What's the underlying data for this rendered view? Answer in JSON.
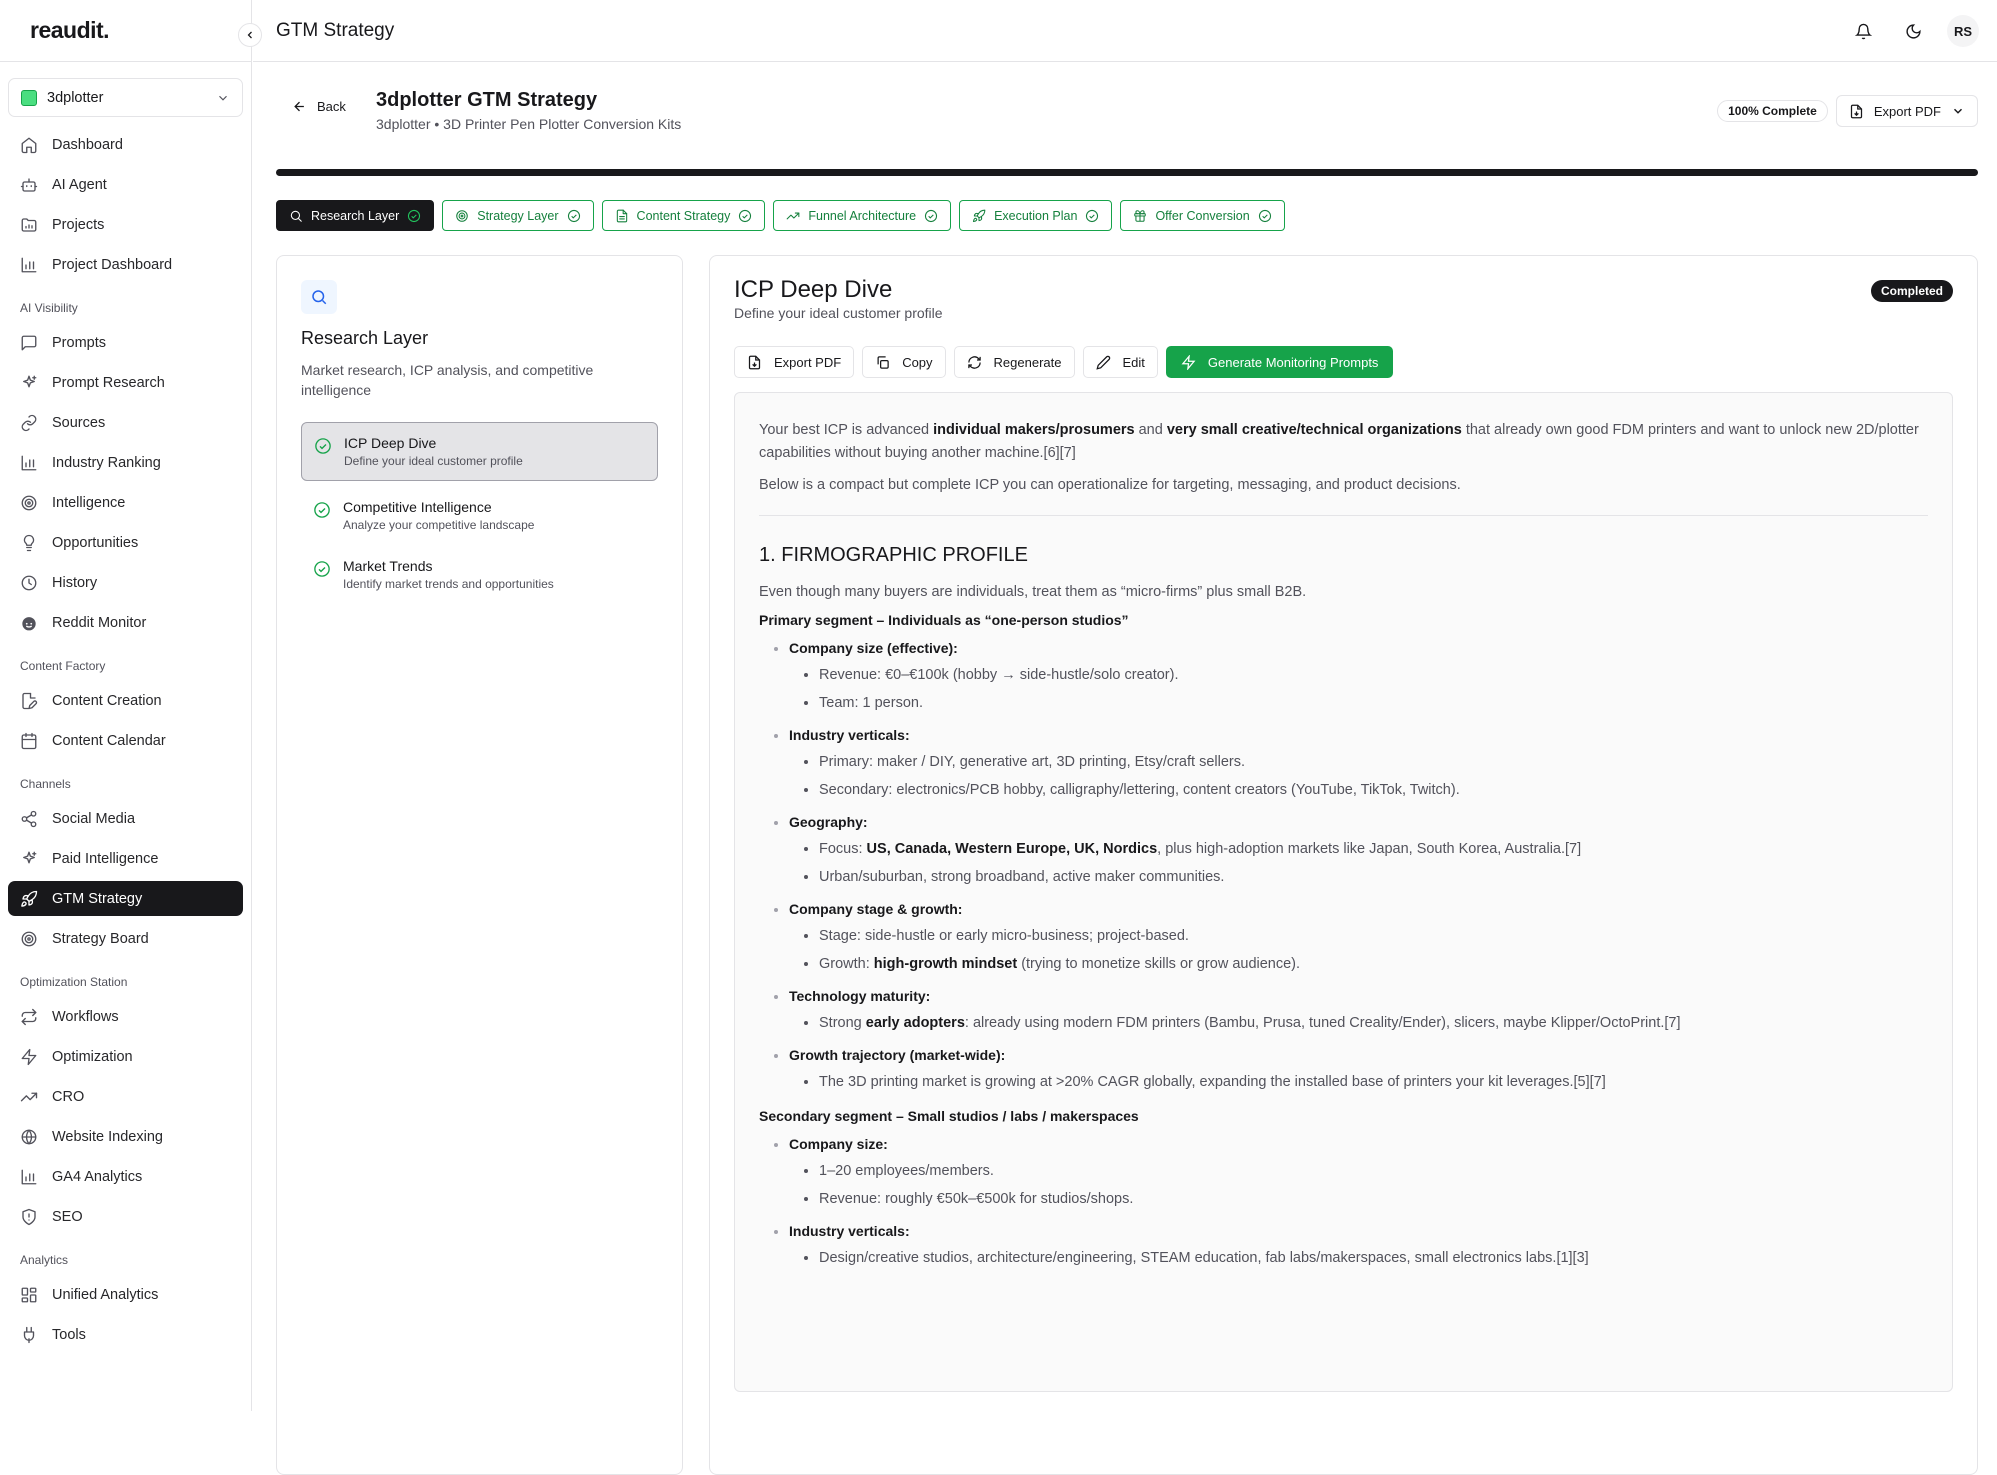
{
  "app": {
    "logo": "reaudit.",
    "page_title": "GTM Strategy",
    "avatar_initials": "RS"
  },
  "sidebar": {
    "project": "3dplotter",
    "groups": [
      {
        "label": "",
        "items": [
          {
            "label": "Dashboard",
            "icon": "home-icon"
          },
          {
            "label": "AI Agent",
            "icon": "bot-icon"
          },
          {
            "label": "Projects",
            "icon": "folder-icon"
          },
          {
            "label": "Project Dashboard",
            "icon": "bar-chart-icon"
          }
        ]
      },
      {
        "label": "AI Visibility",
        "items": [
          {
            "label": "Prompts",
            "icon": "message-icon"
          },
          {
            "label": "Prompt Research",
            "icon": "sparkles-icon"
          },
          {
            "label": "Sources",
            "icon": "link-icon"
          },
          {
            "label": "Industry Ranking",
            "icon": "bar-chart-icon"
          },
          {
            "label": "Intelligence",
            "icon": "target-icon"
          },
          {
            "label": "Opportunities",
            "icon": "lightbulb-icon"
          },
          {
            "label": "History",
            "icon": "clock-icon"
          },
          {
            "label": "Reddit Monitor",
            "icon": "reddit-icon"
          }
        ]
      },
      {
        "label": "Content Factory",
        "items": [
          {
            "label": "Content Creation",
            "icon": "file-pen-icon"
          },
          {
            "label": "Content Calendar",
            "icon": "calendar-icon"
          }
        ]
      },
      {
        "label": "Channels",
        "items": [
          {
            "label": "Social Media",
            "icon": "share-icon"
          },
          {
            "label": "Paid Intelligence",
            "icon": "sparkles-icon"
          },
          {
            "label": "GTM Strategy",
            "icon": "rocket-icon",
            "active": true
          },
          {
            "label": "Strategy Board",
            "icon": "target-icon"
          }
        ]
      },
      {
        "label": "Optimization Station",
        "items": [
          {
            "label": "Workflows",
            "icon": "repeat-icon"
          },
          {
            "label": "Optimization",
            "icon": "zap-icon"
          },
          {
            "label": "CRO",
            "icon": "trending-up-icon"
          },
          {
            "label": "Website Indexing",
            "icon": "globe-icon"
          },
          {
            "label": "GA4 Analytics",
            "icon": "bar-chart-icon"
          },
          {
            "label": "SEO",
            "icon": "shield-icon"
          }
        ]
      },
      {
        "label": "Analytics",
        "items": [
          {
            "label": "Unified Analytics",
            "icon": "grid-icon"
          },
          {
            "label": "Tools",
            "icon": "plug-icon"
          }
        ]
      }
    ]
  },
  "header": {
    "back_label": "Back",
    "title": "3dplotter GTM Strategy",
    "subtitle": "3dplotter • 3D Printer Pen Plotter Conversion Kits",
    "complete_label": "100% Complete",
    "progress": 1.0,
    "export_label": "Export PDF"
  },
  "tabs": [
    {
      "label": "Research Layer",
      "icon": "search-icon",
      "active": true
    },
    {
      "label": "Strategy Layer",
      "icon": "target-icon"
    },
    {
      "label": "Content Strategy",
      "icon": "file-icon"
    },
    {
      "label": "Funnel Architecture",
      "icon": "trending-up-icon"
    },
    {
      "label": "Execution Plan",
      "icon": "rocket-icon"
    },
    {
      "label": "Offer Conversion",
      "icon": "gift-icon"
    }
  ],
  "layer": {
    "title": "Research Layer",
    "description": "Market research, ICP analysis, and competitive intelligence",
    "steps": [
      {
        "title": "ICP Deep Dive",
        "desc": "Define your ideal customer profile",
        "active": true
      },
      {
        "title": "Competitive Intelligence",
        "desc": "Analyze your competitive landscape"
      },
      {
        "title": "Market Trends",
        "desc": "Identify market trends and opportunities"
      }
    ]
  },
  "detail": {
    "title": "ICP Deep Dive",
    "subtitle": "Define your ideal customer profile",
    "status": "Completed",
    "actions": {
      "export": "Export PDF",
      "copy": "Copy",
      "regenerate": "Regenerate",
      "edit": "Edit",
      "generate": "Generate Monitoring Prompts"
    },
    "content": {
      "intro_1a": "Your best ICP is advanced ",
      "intro_1b": "individual makers/prosumers",
      "intro_1c": " and ",
      "intro_1d": "very small creative/technical organizations",
      "intro_1e": " that already own good FDM printers and want to unlock new 2D/plotter capabilities without buying another machine.[6][7]",
      "intro_2": "Below is a compact but complete ICP you can operationalize for targeting, messaging, and product decisions.",
      "h1": "1. FIRMOGRAPHIC PROFILE",
      "lead": "Even though many buyers are individuals, treat them as “micro-firms” plus small B2B.",
      "seg1": "Primary segment – Individuals as “one-person studios”",
      "s1": [
        {
          "h": "Company size (effective):",
          "items": [
            "Revenue: €0–€100k (hobby → side-hustle/solo creator).",
            "Team: 1 person."
          ]
        },
        {
          "h": "Industry verticals:",
          "items": [
            "Primary: maker / DIY, generative art, 3D printing, Etsy/craft sellers.",
            "Secondary: electronics/PCB hobby, calligraphy/lettering, content creators (YouTube, TikTok, Twitch)."
          ]
        },
        {
          "h": "Geography:",
          "items": []
        },
        {
          "h": "Company stage & growth:",
          "items": [
            "Stage: side-hustle or early micro-business; project-based."
          ]
        },
        {
          "h": "Technology maturity:",
          "items": []
        },
        {
          "h": "Growth trajectory (market-wide):",
          "items": [
            "The 3D printing market is growing at >20% CAGR globally, expanding the installed base of printers your kit leverages.[5][7]"
          ]
        }
      ],
      "geo_a": "Focus: ",
      "geo_b": "US, Canada, Western Europe, UK, Nordics",
      "geo_c": ", plus high-adoption markets like Japan, South Korea, Australia.[7]",
      "geo_2": "Urban/suburban, strong broadband, active maker communities.",
      "growth_a": "Growth: ",
      "growth_b": "high-growth mindset",
      "growth_c": " (trying to monetize skills or grow audience).",
      "tech_a": "Strong ",
      "tech_b": "early adopters",
      "tech_c": ": already using modern FDM printers (Bambu, Prusa, tuned Creality/Ender), slicers, maybe Klipper/OctoPrint.[7]",
      "seg2": "Secondary segment – Small studios / labs / makerspaces",
      "s2": [
        {
          "h": "Company size:",
          "items": [
            "1–20 employees/members.",
            "Revenue: roughly €50k–€500k for studios/shops."
          ]
        },
        {
          "h": "Industry verticals:",
          "items": [
            "Design/creative studios, architecture/engineering, STEAM education, fab labs/makerspaces, small electronics labs.[1][3]"
          ]
        }
      ]
    }
  },
  "colors": {
    "accent": "#16a34a",
    "dark": "#18181b"
  }
}
